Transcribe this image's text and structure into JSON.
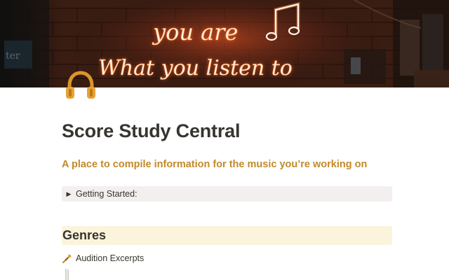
{
  "cover": {
    "neon_line_1": "you are",
    "neon_line_2": "What you listen to",
    "note_icon": "music-note-icon"
  },
  "page": {
    "icon": "headphones-icon",
    "title": "Score Study Central",
    "subtitle": "A place to compile information for the music you’re working on"
  },
  "toggle": {
    "icon": "triangle-right-icon",
    "label": "Getting Started:"
  },
  "genres": {
    "heading": "Genres",
    "items": [
      {
        "icon": "trumpet-icon",
        "label": "Audition Excerpts"
      }
    ]
  },
  "colors": {
    "subtitle": "#c28a2a",
    "toggle_bg": "#f3efee",
    "heading_bg": "#fbf3db",
    "neon": "#ff8a3d"
  }
}
